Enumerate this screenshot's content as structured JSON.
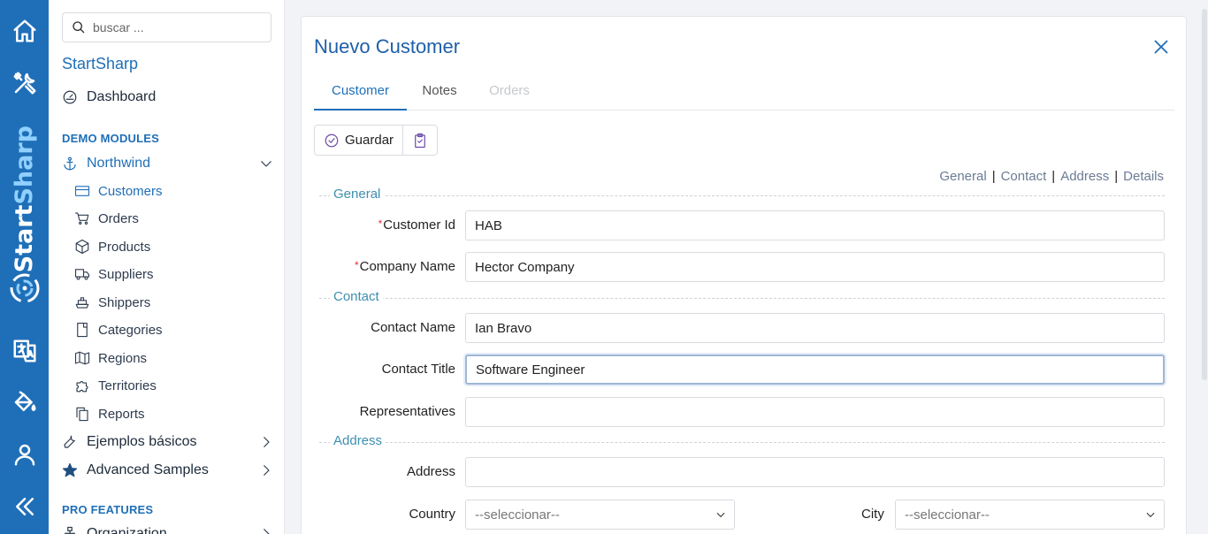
{
  "rail": {
    "brand_main": "Start",
    "brand_accent": "Sharp",
    "icons": [
      "home-icon",
      "tools-icon",
      "translate-icon",
      "paint-bucket-icon",
      "user-icon",
      "collapse-icon"
    ]
  },
  "sidebar": {
    "search_placeholder": "buscar ...",
    "app_title": "StartSharp",
    "dashboard": "Dashboard",
    "section_demo": "DEMO MODULES",
    "northwind": "Northwind",
    "items": [
      {
        "label": "Customers",
        "icon": "card-icon"
      },
      {
        "label": "Orders",
        "icon": "cart-icon"
      },
      {
        "label": "Products",
        "icon": "box-icon"
      },
      {
        "label": "Suppliers",
        "icon": "truck-icon"
      },
      {
        "label": "Shippers",
        "icon": "ship-icon"
      },
      {
        "label": "Categories",
        "icon": "page-icon"
      },
      {
        "label": "Regions",
        "icon": "map-icon"
      },
      {
        "label": "Territories",
        "icon": "puzzle-icon"
      },
      {
        "label": "Reports",
        "icon": "copy-icon"
      }
    ],
    "basic_samples": "Ejemplos básicos",
    "advanced_samples": "Advanced Samples",
    "section_pro": "PRO FEATURES",
    "organization": "Organization"
  },
  "dialog": {
    "title": "Nuevo Customer",
    "tabs": [
      "Customer",
      "Notes",
      "Orders"
    ],
    "save_label": "Guardar",
    "category_links": [
      "General",
      "Contact",
      "Address",
      "Details"
    ],
    "sections": {
      "general": "General",
      "contact": "Contact",
      "address": "Address"
    },
    "fields": {
      "customer_id": {
        "label": "Customer Id",
        "value": "HAB"
      },
      "company_name": {
        "label": "Company Name",
        "value": "Hector Company"
      },
      "contact_name": {
        "label": "Contact Name",
        "value": "Ian Bravo"
      },
      "contact_title": {
        "label": "Contact Title",
        "value": "Software Engineer"
      },
      "representatives": {
        "label": "Representatives",
        "value": ""
      },
      "address": {
        "label": "Address",
        "value": ""
      },
      "country": {
        "label": "Country",
        "value": "--seleccionar--"
      },
      "city": {
        "label": "City",
        "value": "--seleccionar--"
      }
    }
  },
  "colors": {
    "rail": "#1f6fb8",
    "accent": "#1f6fb8",
    "legend": "#3d8fb0",
    "required": "#dd3333"
  }
}
